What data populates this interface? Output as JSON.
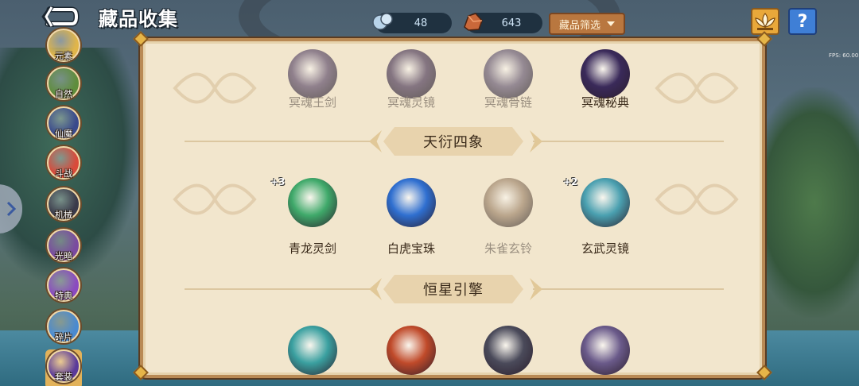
{
  "header": {
    "title": "藏品收集",
    "resource_1": "48",
    "resource_2": "643",
    "filter_label": "藏品筛选",
    "help_label": "?"
  },
  "fps_label": "FPS: 60.00",
  "colors": {
    "accent": "#b9773f",
    "panel_bg": "#f2e6cd",
    "panel_border": "#b98a55",
    "help_blue": "#3f7fd6",
    "lotus_gold": "#e9a83a"
  },
  "categories": [
    {
      "label": "元素",
      "icon": "element-icon",
      "color": "#e0b54a"
    },
    {
      "label": "自然",
      "icon": "tree-icon",
      "color": "#5f8d3c"
    },
    {
      "label": "仙魔",
      "icon": "demon-icon",
      "color": "#3a4a8c"
    },
    {
      "label": "斗战",
      "icon": "battle-orb-icon",
      "color": "#d94a3a"
    },
    {
      "label": "机械",
      "icon": "mech-icon",
      "color": "#3a3a4a"
    },
    {
      "label": "光暗",
      "icon": "light-dark-icon",
      "color": "#7a4aa0"
    },
    {
      "label": "特典",
      "icon": "special-crystal-icon",
      "color": "#8a4ac0"
    },
    {
      "label": "碎片",
      "icon": "fragment-icon",
      "color": "#4a8ad0"
    },
    {
      "label": "套装",
      "icon": "set-icon",
      "color": "#5a3a9a",
      "active": true
    }
  ],
  "sections": [
    {
      "title": "",
      "items": [
        {
          "name": "冥魂王剑",
          "locked": true,
          "color": "#7a4a9a"
        },
        {
          "name": "冥魂灵镜",
          "locked": true,
          "color": "#6a3a8a"
        },
        {
          "name": "冥魂骨链",
          "locked": true,
          "color": "#7a5aa0"
        },
        {
          "name": "冥魂秘典",
          "locked": false,
          "color": "#3a2a5a"
        }
      ]
    },
    {
      "title": "天衍四象",
      "items": [
        {
          "name": "青龙灵剑",
          "locked": false,
          "level": "+3",
          "color": "#3fa96a"
        },
        {
          "name": "白虎宝珠",
          "locked": false,
          "level": "",
          "color": "#2f6fd0"
        },
        {
          "name": "朱雀玄铃",
          "locked": true,
          "level": "",
          "color": "#c9843a"
        },
        {
          "name": "玄武灵镜",
          "locked": false,
          "level": "+2",
          "color": "#4aa0b0"
        }
      ]
    },
    {
      "title": "恒星引擎",
      "items": [
        {
          "name": "",
          "locked": false,
          "color": "#3aa0a0"
        },
        {
          "name": "",
          "locked": false,
          "color": "#c04a2a"
        },
        {
          "name": "",
          "locked": false,
          "color": "#4a4a5a"
        },
        {
          "name": "",
          "locked": false,
          "color": "#6a5a8a"
        }
      ]
    }
  ]
}
